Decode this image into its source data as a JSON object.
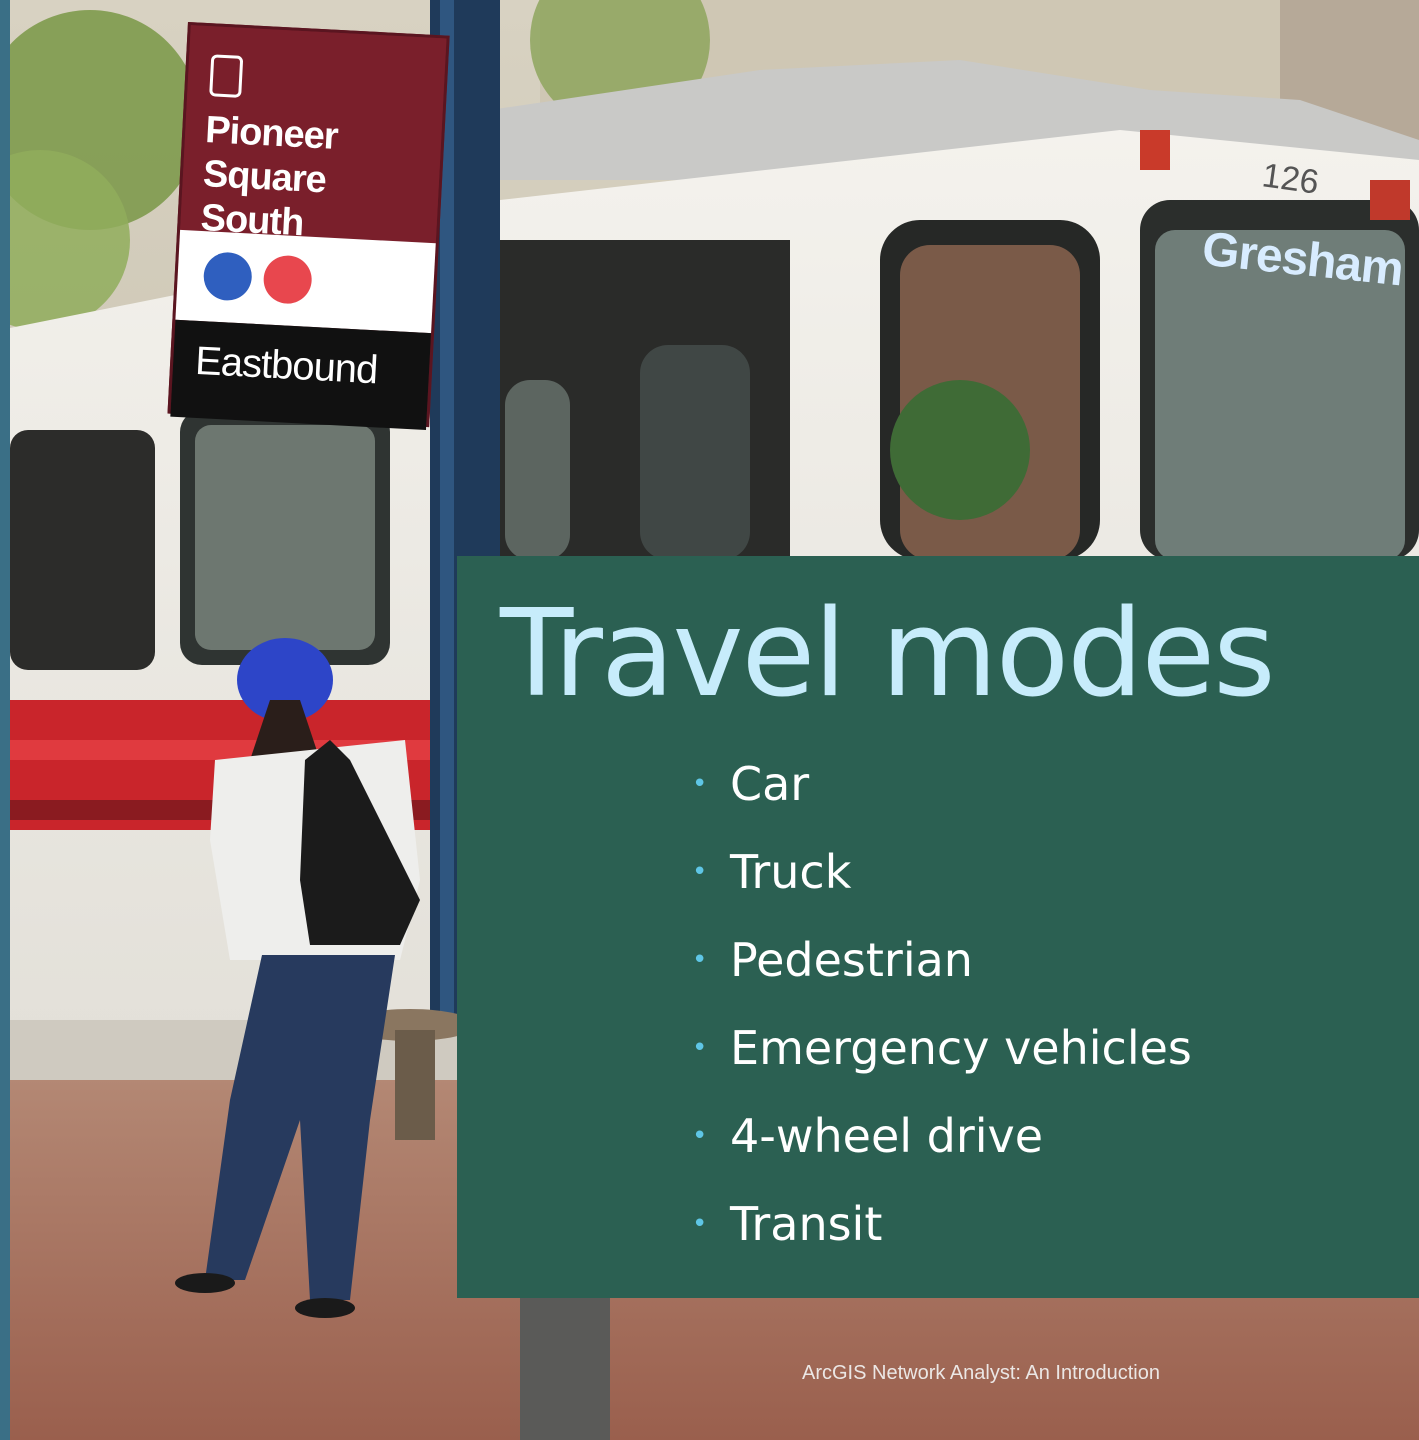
{
  "slide": {
    "title": "Travel modes",
    "bullets": [
      "Car",
      "Truck",
      "Pedestrian",
      "Emergency vehicles",
      "4-wheel drive",
      "Transit"
    ],
    "footer": "ArcGIS Network Analyst: An Introduction"
  },
  "photo": {
    "sign_name": "Pioneer\nSquare South",
    "sign_direction": "Eastbound",
    "tram_number": "126",
    "tram_destination": "Gresham"
  },
  "colors": {
    "panel": "#2b6052",
    "title": "#c7ecfb",
    "bullet_marker": "#5fc6e6",
    "sign_maroon": "#7a1f2b"
  }
}
